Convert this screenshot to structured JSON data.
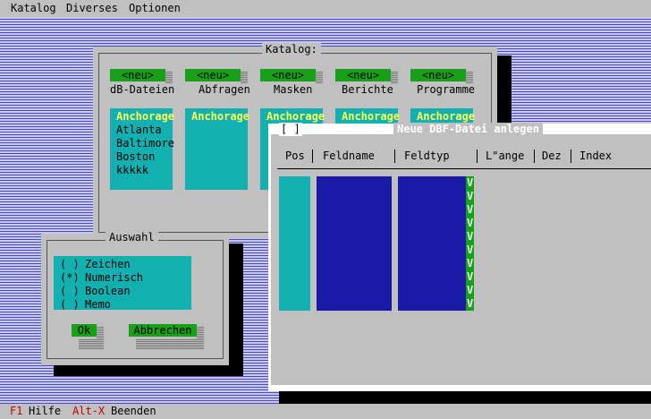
{
  "menubar": {
    "items": [
      "Katalog",
      "Diverses",
      "Optionen"
    ]
  },
  "status": {
    "key1": "F1",
    "label1": "Hilfe",
    "key2": "Alt-X",
    "label2": "Beenden"
  },
  "catalog": {
    "title": "Katalog:",
    "new_label": "<neu>",
    "columns": [
      {
        "label": "dB-Dateien",
        "items": [
          "Anchorage",
          "Atlanta",
          "Baltimore",
          "Boston",
          "kkkkk"
        ]
      },
      {
        "label": "Abfragen",
        "items": [
          "Anchorage"
        ]
      },
      {
        "label": "Masken",
        "items": [
          "Anchorage"
        ]
      },
      {
        "label": "Berichte",
        "items": [
          "Anchorage"
        ]
      },
      {
        "label": "Programme",
        "items": [
          "Anchorage"
        ]
      }
    ]
  },
  "auswahl": {
    "title": "Auswahl",
    "options": [
      {
        "mark": "( )",
        "label": "Zeichen"
      },
      {
        "mark": "(*)",
        "label": "Numerisch"
      },
      {
        "mark": "( )",
        "label": "Boolean"
      },
      {
        "mark": "( )",
        "label": "Memo"
      }
    ],
    "ok_label": "Ok",
    "cancel_label": "Abbrechen"
  },
  "dbf": {
    "close_label": "[ ]",
    "title": "Neue DBF-Datei anlegen",
    "headers": [
      "Pos",
      "Feldname",
      "Feldtyp",
      "L\"ange",
      "Dez",
      "Index"
    ],
    "arrow_glyph": "V"
  },
  "colors": {
    "desktop": "#aeaee0",
    "window": "#c0c0c0",
    "button": "#18a018",
    "listbox": "#12b0b0",
    "highlight_text": "#ffff50",
    "field_blue": "#1a1aa8",
    "hotkey": "#c00000"
  }
}
